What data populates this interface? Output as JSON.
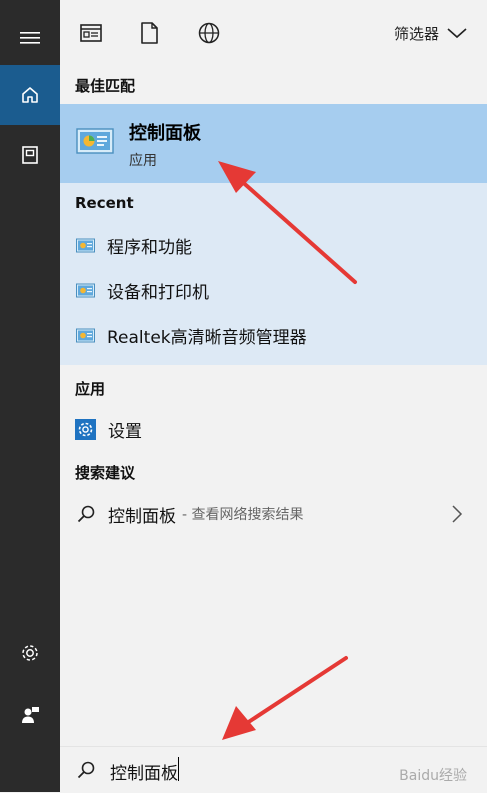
{
  "filter": {
    "label": "筛选器"
  },
  "sections": {
    "best_match": "最佳匹配",
    "recent": "Recent",
    "apps": "应用",
    "suggestions": "搜索建议"
  },
  "best_match": {
    "title": "控制面板",
    "subtitle": "应用"
  },
  "recent_items": [
    {
      "label": "程序和功能"
    },
    {
      "label": "设备和打印机"
    },
    {
      "label": "Realtek高清晰音频管理器"
    }
  ],
  "apps": [
    {
      "label": "设置"
    }
  ],
  "suggestion": {
    "label": "控制面板",
    "hint": " - 查看网络搜索结果"
  },
  "search": {
    "value": "控制面板"
  },
  "watermark": "Baidu经验",
  "colors": {
    "rail": "#2b2b2b",
    "rail_active": "#1b5c8f",
    "panel": "#f2f2f2",
    "best_highlight": "#a6cdef",
    "recent_bg": "#dde9f5",
    "annotation_arrow": "#e53935"
  }
}
